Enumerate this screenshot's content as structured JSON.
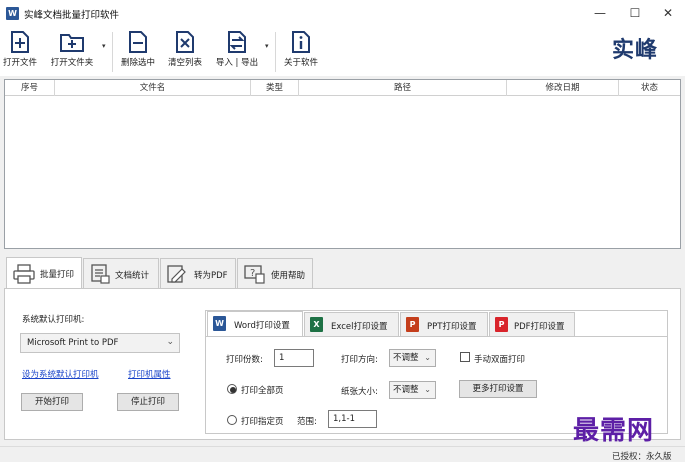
{
  "window": {
    "icon_letter": "W",
    "title": "实峰文档批量打印软件",
    "minimize": "—",
    "maximize": "☐",
    "close": "✕"
  },
  "toolbar": {
    "open_file": "打开文件",
    "open_folder": "打开文件夹",
    "delete_selected": "删除选中",
    "clear_list": "清空列表",
    "import_export": "导入 | 导出",
    "about": "关于软件",
    "dropdown_caret": "▾"
  },
  "brand": "实峰",
  "table": {
    "columns": [
      "序号",
      "文件名",
      "类型",
      "路径",
      "修改日期",
      "状态"
    ],
    "rows": []
  },
  "main_tabs": [
    {
      "label": "批量打印",
      "icon": "printer-icon"
    },
    {
      "label": "文档统计",
      "icon": "document-stats-icon"
    },
    {
      "label": "转为PDF",
      "icon": "convert-pdf-icon"
    },
    {
      "label": "使用帮助",
      "icon": "help-icon"
    }
  ],
  "printer": {
    "label": "系统默认打印机:",
    "selected": "Microsoft Print to PDF",
    "set_default_link": "设为系统默认打印机",
    "properties_link": "打印机属性",
    "start_button": "开始打印",
    "stop_button": "停止打印"
  },
  "sub_tabs": [
    {
      "label": "Word打印设置",
      "icon_letter": "W",
      "color": "#2b5797"
    },
    {
      "label": "Excel打印设置",
      "icon_letter": "X",
      "color": "#1e7145"
    },
    {
      "label": "PPT打印设置",
      "icon_letter": "P",
      "color": "#c43e1c"
    },
    {
      "label": "PDF打印设置",
      "icon_letter": "P",
      "color": "#d9242b"
    }
  ],
  "word_settings": {
    "copies_label": "打印份数:",
    "copies_value": "1",
    "orientation_label": "打印方向:",
    "orientation_value": "不调整",
    "duplex_label": "手动双面打印",
    "print_all_label": "打印全部页",
    "paper_size_label": "纸张大小:",
    "paper_size_value": "不调整",
    "more_settings_button": "更多打印设置",
    "print_range_label": "打印指定页",
    "range_label": "范围:",
    "range_value": "1,1-1"
  },
  "watermark": "最需网",
  "status": "已授权：永久版"
}
